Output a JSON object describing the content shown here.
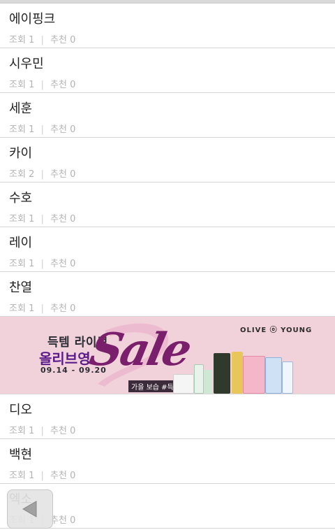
{
  "items_top": [
    {
      "title": "에이핑크",
      "views_label": "조회",
      "views": "1",
      "likes_label": "추천",
      "likes": "0"
    },
    {
      "title": "시우민",
      "views_label": "조회",
      "views": "1",
      "likes_label": "추천",
      "likes": "0"
    },
    {
      "title": "세훈",
      "views_label": "조회",
      "views": "1",
      "likes_label": "추천",
      "likes": "0"
    },
    {
      "title": "카이",
      "views_label": "조회",
      "views": "2",
      "likes_label": "추천",
      "likes": "0"
    },
    {
      "title": "수호",
      "views_label": "조회",
      "views": "1",
      "likes_label": "추천",
      "likes": "0"
    },
    {
      "title": "레이",
      "views_label": "조회",
      "views": "1",
      "likes_label": "추천",
      "likes": "0"
    },
    {
      "title": "찬열",
      "views_label": "조회",
      "views": "1",
      "likes_label": "추천",
      "likes": "0"
    }
  ],
  "banner": {
    "line1": "득템 라이브",
    "line2": "올리브영",
    "dates": "09.14 - 09.20",
    "sale": "Sale",
    "brand": "OLIVE ⓞ YOUNG",
    "tag": "가을 보습 #득템"
  },
  "items_bottom": [
    {
      "title": "디오",
      "views_label": "조회",
      "views": "1",
      "likes_label": "추천",
      "likes": "0"
    },
    {
      "title": "백현",
      "views_label": "조회",
      "views": "1",
      "likes_label": "추천",
      "likes": "0"
    },
    {
      "title": "엑소",
      "views_label": "조회",
      "views": "1",
      "likes_label": "추천",
      "likes": "0"
    }
  ],
  "separator": "|",
  "colors": {
    "banner_bg": "#f2d2da",
    "sale": "#7a1f6b",
    "meta": "#b3b3b3"
  },
  "icons": {
    "back": "back-arrow-icon"
  }
}
